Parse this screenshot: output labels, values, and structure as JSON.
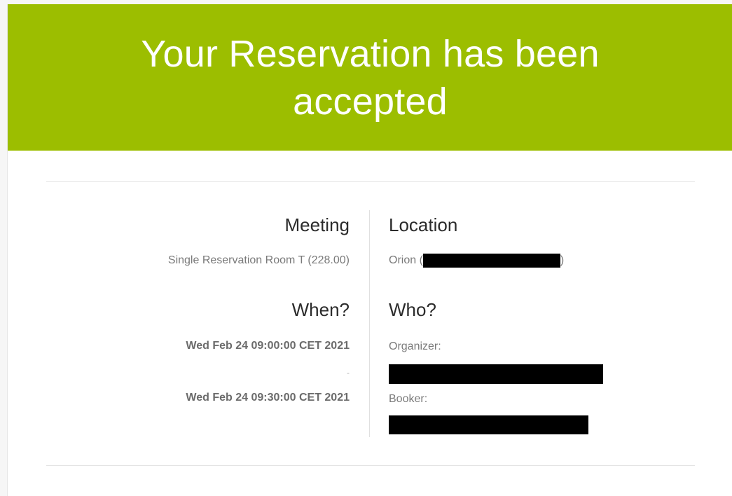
{
  "banner": {
    "title": "Your Reservation has been accepted"
  },
  "meeting": {
    "heading": "Meeting",
    "value": "Single Reservation Room T (228.00)"
  },
  "location": {
    "heading": "Location",
    "value_prefix": "Orion (",
    "value_suffix": ")"
  },
  "when": {
    "heading": "When?",
    "start": "Wed Feb 24 09:00:00 CET 2021",
    "separator": "-",
    "end": "Wed Feb 24 09:30:00 CET 2021"
  },
  "who": {
    "heading": "Who?",
    "organizer_label": "Organizer:",
    "booker_label": "Booker:"
  },
  "colors": {
    "banner_green": "#9cbe00",
    "redaction": "#000000"
  }
}
